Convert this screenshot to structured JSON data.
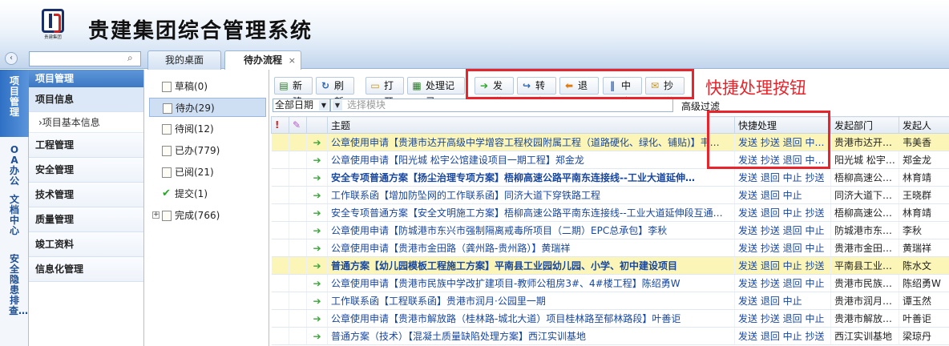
{
  "app": {
    "title": "贵建集团综合管理系统",
    "logo_text": "贵建集团"
  },
  "colors": {
    "accent": "#3d78c4",
    "highlight": "#e8242c",
    "selected_row": "#fbf5b8",
    "action_green": "#3aa63a"
  },
  "tabs": [
    {
      "label": "我的桌面"
    },
    {
      "label": "待办流程",
      "close": "×"
    }
  ],
  "collapse_glyph": "‹",
  "left_nav": [
    {
      "label": "项目管理"
    },
    {
      "label": "OA办公"
    },
    {
      "label": "文档中心"
    },
    {
      "label": "安全隐患排查…"
    }
  ],
  "menu": {
    "header": "项目管理",
    "groups": [
      {
        "label": "项目信息"
      },
      {
        "label": "›项目基本信息"
      },
      {
        "label": "工程管理"
      },
      {
        "label": "安全管理"
      },
      {
        "label": "技术管理"
      },
      {
        "label": "质量管理"
      },
      {
        "label": "竣工资料"
      },
      {
        "label": "信息化管理"
      }
    ]
  },
  "folders": [
    {
      "label": "草稿(0)"
    },
    {
      "label": "待办(29)"
    },
    {
      "label": "待阅(12)"
    },
    {
      "label": "已办(779)"
    },
    {
      "label": "已阅(21)"
    },
    {
      "label": "提交(1)"
    },
    {
      "label": "完成(766)"
    }
  ],
  "toolbar": {
    "new": "新建",
    "refresh": "刷新",
    "open": "打开",
    "records": "处理记录",
    "send": "发送",
    "forward": "转发",
    "return": "退回",
    "stop": "中止",
    "cc": "抄送"
  },
  "annotation": "快捷处理按钮",
  "filter": {
    "date": "全部日期",
    "module_placeholder": "选择模块",
    "advanced": "高级过滤"
  },
  "grid": {
    "columns": {
      "subject": "主题",
      "quick": "快捷处理",
      "dept": "发起部门",
      "sender": "发起人"
    },
    "rows": [
      {
        "subject": "公章使用申请【贵港市达开高级中学增容工程校园附属工程（道路硬化、绿化、铺贴)】韦…",
        "quick": "发送 抄送 退回 中止 转发",
        "dept": "贵港市达开…",
        "sender": "韦美香",
        "selected": true,
        "bold": false
      },
      {
        "subject": "公章使用申请【阳光城 松宇公馆建设项目一期工程】郑金龙",
        "quick": "发送 抄送 退回 中止 转发",
        "dept": "阳光城 松宇…",
        "sender": "郑金龙",
        "selected": false,
        "bold": false
      },
      {
        "subject": "安全专项普通方案【扬尘治理专项方案】梧柳高速公路平南东连接线--工业大道延伸…",
        "quick": "发送 退回 中止 抄送",
        "dept": "梧柳高速公…",
        "sender": "林育靖",
        "selected": false,
        "bold": true
      },
      {
        "subject": "工作联系函【增加防坠网的工作联系函】同济大道下穿铁路工程",
        "quick": "发送 退回 中止",
        "dept": "同济大道下…",
        "sender": "王晓群",
        "selected": false,
        "bold": false
      },
      {
        "subject": "安全专项普通方案【安全文明施工方案】梧柳高速公路平南东连接线--工业大道延伸段互通…",
        "quick": "发送 退回 中止 抄送",
        "dept": "梧柳高速公…",
        "sender": "林育靖",
        "selected": false,
        "bold": false
      },
      {
        "subject": "公章使用申请【防城港市东兴市强制隔离戒毒所项目（二期）EPC总承包】李秋",
        "quick": "发送 抄送 退回 中止",
        "dept": "防城港市东…",
        "sender": "李秋",
        "selected": false,
        "bold": false
      },
      {
        "subject": "公章使用申请【贵港市金田路（龚州路-贵州路）】黄瑞祥",
        "quick": "发送 抄送 退回 中止",
        "dept": "贵港市金田…",
        "sender": "黄瑞祥",
        "selected": false,
        "bold": false
      },
      {
        "subject": "普通方案【幼儿园模板工程施工方案】平南县工业园幼儿园、小学、初中建设项目",
        "quick": "发送 退回 中止 抄送",
        "dept": "平南县工业…",
        "sender": "陈水文",
        "selected": true,
        "bold": true
      },
      {
        "subject": "公章使用申请【贵港市民族中学改扩建项目-教师公租房3#、4#楼工程】陈绍勇W",
        "quick": "发送 抄送 退回 中止",
        "dept": "贵港市民族…",
        "sender": "陈绍勇W",
        "selected": false,
        "bold": false
      },
      {
        "subject": "工作联系函【工程联系函】贵港市润月·公园里一期",
        "quick": "发送 退回 中止",
        "dept": "贵港市润月…",
        "sender": "谭玉然",
        "selected": false,
        "bold": false
      },
      {
        "subject": "公章使用申请【贵港市解放路（桂林路-城北大道）项目桂林路至郁林路段】叶善讵",
        "quick": "发送 抄送 退回 中止",
        "dept": "贵港市解放…",
        "sender": "叶善讵",
        "selected": false,
        "bold": false
      },
      {
        "subject": "普通方案（技术）【混凝土质量缺陷处理方案】西江实训基地",
        "quick": "发送 退回 中止 抄送",
        "dept": "西江实训基地",
        "sender": "梁琼丹",
        "selected": false,
        "bold": false
      }
    ]
  }
}
